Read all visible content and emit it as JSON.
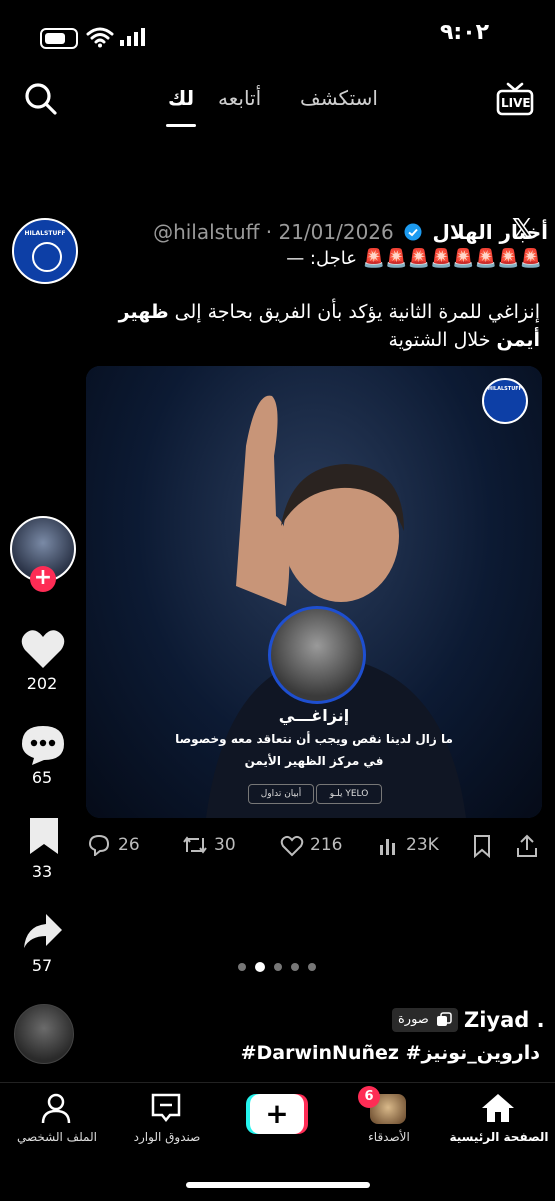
{
  "status": {
    "time": "٩:٠٢"
  },
  "topnav": {
    "live": "LIVE",
    "explore": "استكشف",
    "following": "أتابعه",
    "for_you": "لك"
  },
  "tweet": {
    "account_name": "أخبار الهلال",
    "handle_date": "@hilalstuff · 21/01/2026",
    "x_logo": "𝕏",
    "breaking": "عاجل: —",
    "alarms": "🚨🚨🚨🚨🚨🚨🚨🚨",
    "text_plain_1": "إنزاغي للمرة الثانية يؤكد بأن الفريق بحاجة إلى ",
    "text_bold_1": "ظهير",
    "text_bold_2": "أيمن",
    "text_plain_2": " خلال الشتوية",
    "avatar_text": "HILALSTUFF",
    "media": {
      "logo_text": "HILALSTUFF",
      "name_tag": "إنزاغـــي",
      "quote_line1": "ما زال لدينا نقص ويجب أن نتعاقد معه وخصوصا",
      "quote_line2": "في مركز الظهير الأيمن",
      "sponsor1": "يلـو YELO",
      "sponsor2": "أبيان تداول"
    },
    "stats": {
      "replies": "26",
      "retweets": "30",
      "likes": "216",
      "views": "23K"
    }
  },
  "side": {
    "likes": "202",
    "comments": "65",
    "saves": "33",
    "shares": "57"
  },
  "post": {
    "username": "Ziyad .",
    "badge": "صورة",
    "hashtags": "داروين_نونيز# DarwinNuñez#"
  },
  "bottomnav": {
    "home": "الصفحة الرئيسية",
    "friends": "الأصدقاء",
    "friends_badge": "6",
    "inbox": "صندوق الوارد",
    "profile": "الملف الشخصي"
  },
  "colors": {
    "accent_red": "#fe2c55",
    "accent_cyan": "#25f4ee",
    "verified_blue": "#1d9bf0",
    "hilal_blue": "#0d3fa6"
  }
}
